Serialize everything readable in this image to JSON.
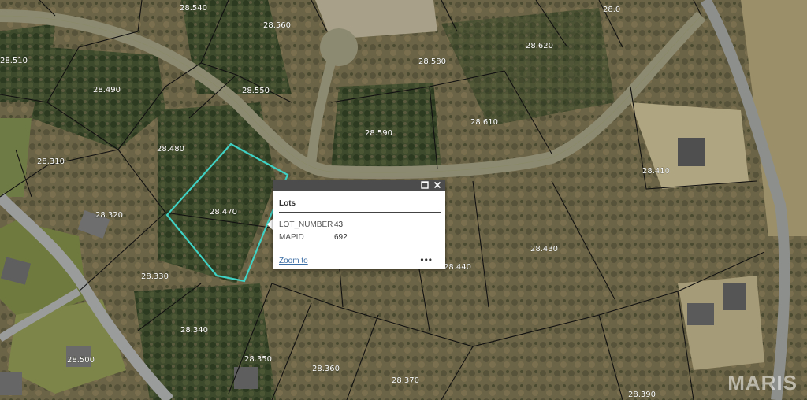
{
  "map": {
    "lot_labels": [
      "28.540",
      "28.560",
      "28.0",
      "28.510",
      "28.580",
      "28.620",
      "28.490",
      "28.550",
      "28.610",
      "28.590",
      "28.310",
      "28.480",
      "28.410",
      "28.470",
      "28.320",
      "28.430",
      "28.440",
      "28.330",
      "28.340",
      "28.350",
      "28.500",
      "28.360",
      "28.370",
      "28.390"
    ],
    "selected_parcel": "28.470"
  },
  "popup": {
    "title": "Lots",
    "rows": [
      {
        "key": "LOT_NUMBER",
        "value": "43"
      },
      {
        "key": "MAPID",
        "value": "692"
      }
    ],
    "zoom_label": "Zoom to",
    "more_label": "•••",
    "maximize_icon": "maximize-icon",
    "close_icon": "close-icon"
  },
  "watermark": "MARIS"
}
